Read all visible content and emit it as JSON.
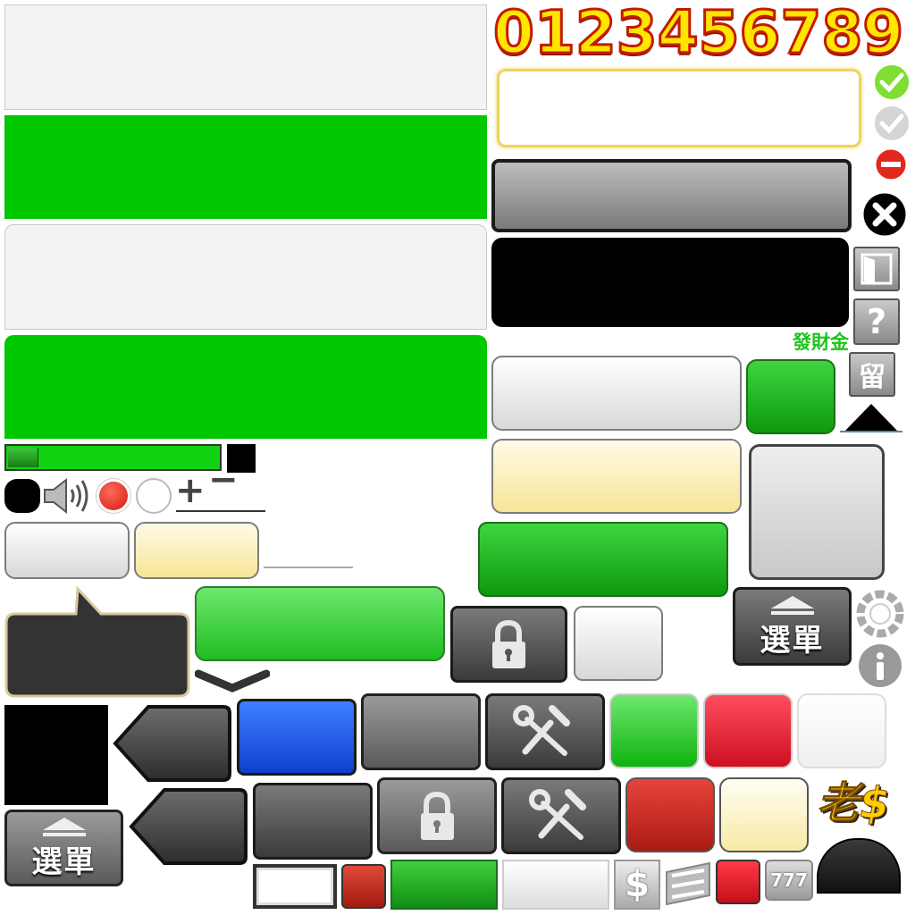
{
  "score_digits": "0123456789",
  "bonus_label": "發財金",
  "stay_label": "留",
  "help_label": "?",
  "menu_label": "選單",
  "plus_label": "+",
  "minus_label": "−",
  "logo_text": "老$",
  "slot_label": "777",
  "dollar_label": "$",
  "progress": {
    "value": 0.14
  },
  "colors": {
    "green": "#00c800",
    "accent_yellow": "#ffe500",
    "accent_red": "#c31b00",
    "dark": "#2e2e2e"
  },
  "icons": [
    "check-icon",
    "close-icon",
    "minus-circle-icon",
    "help-icon",
    "exit-door-icon",
    "speaker-icon",
    "record-icon",
    "lock-icon",
    "tools-icon",
    "eject-icon",
    "info-icon",
    "loading-icon",
    "triangle-up-icon",
    "chevron-down-icon",
    "slot-777-icon",
    "dollar-card-icon"
  ]
}
